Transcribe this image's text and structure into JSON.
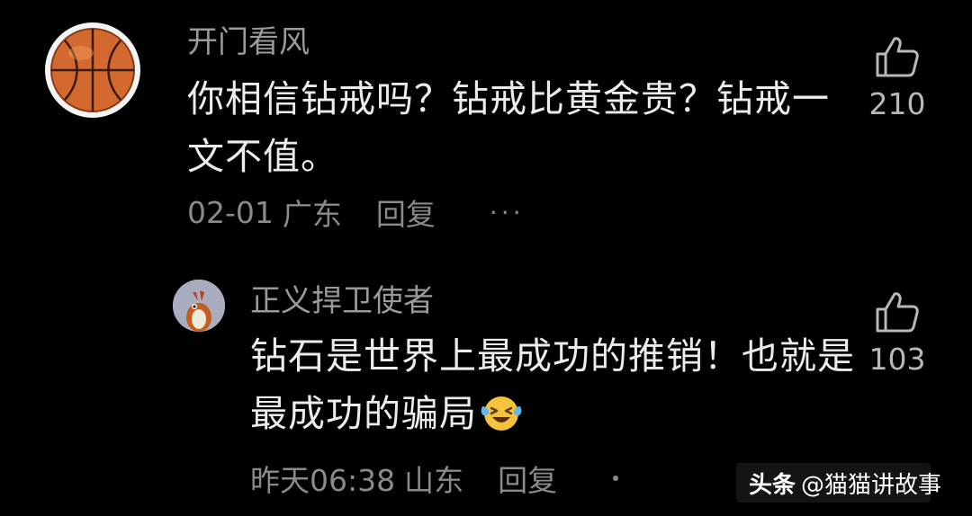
{
  "comment": {
    "username": "开门看风",
    "text": "你相信钻戒吗？钻戒比黄金贵？钻戒一文不值。",
    "date": "02-01",
    "location": "广东",
    "reply_label": "回复",
    "more_label": "···",
    "like_count": "210",
    "avatar_icon": "basketball-icon"
  },
  "reply": {
    "username": "正义捍卫使者",
    "text": "钻石是世界上最成功的推销！也就是最成功的骗局",
    "emoji": "laughing-crying-emoji",
    "time": "昨天06:38",
    "location": "山东",
    "reply_label": "回复",
    "like_count": "103",
    "avatar_icon": "bird-avatar-icon"
  },
  "watermark": {
    "brand": "头条",
    "handle": "@猫猫讲故事"
  },
  "colors": {
    "background": "#000000",
    "text_primary": "#ececec",
    "text_secondary": "#8a8a8a",
    "emoji_yellow": "#f5c33b",
    "emoji_tear": "#5fb8f0"
  }
}
